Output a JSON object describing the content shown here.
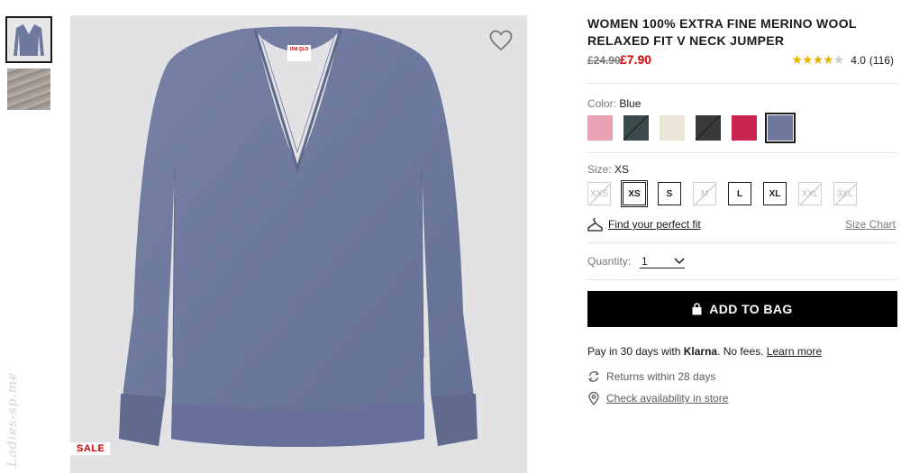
{
  "product": {
    "title": "WOMEN 100% EXTRA FINE MERINO WOOL RELAXED FIT V NECK JUMPER",
    "old_price": "£24.90",
    "new_price": "£7.90",
    "rating_value": "4.0",
    "review_count": "(116)",
    "rating_stars": 4,
    "sale_badge": "SALE",
    "brand_tag": "UNI QLO"
  },
  "watermark": "Ladies-sp.me",
  "color": {
    "label": "Color:",
    "selected": "Blue",
    "swatches": [
      {
        "name": "pink",
        "hex": "#e8a3b4",
        "available": true
      },
      {
        "name": "dark-green",
        "hex": "#3b4a4c",
        "available": false
      },
      {
        "name": "off-white",
        "hex": "#ece6d8",
        "available": true
      },
      {
        "name": "dark-grey",
        "hex": "#3a3939",
        "available": false
      },
      {
        "name": "magenta",
        "hex": "#c8254e",
        "available": true
      },
      {
        "name": "blue",
        "hex": "#6f799e",
        "available": true,
        "selected": true
      }
    ]
  },
  "size": {
    "label": "Size:",
    "selected": "XS",
    "options": [
      {
        "label": "XXS",
        "available": false
      },
      {
        "label": "XS",
        "available": true,
        "selected": true
      },
      {
        "label": "S",
        "available": true
      },
      {
        "label": "M",
        "available": false
      },
      {
        "label": "L",
        "available": true
      },
      {
        "label": "XL",
        "available": true
      },
      {
        "label": "XXL",
        "available": false
      },
      {
        "label": "3XL",
        "available": false
      }
    ]
  },
  "fit": {
    "find_link": "Find your perfect fit",
    "size_chart": "Size Chart"
  },
  "quantity": {
    "label": "Quantity:",
    "value": "1"
  },
  "cart": {
    "add_label": "ADD TO BAG"
  },
  "klarna": {
    "prefix": "Pay in 30 days with ",
    "brand": "Klarna",
    "suffix": ". No fees. ",
    "link": "Learn more"
  },
  "returns": "Returns within 28 days",
  "store": "Check availability in store",
  "colors": {
    "accent_red": "#dd0000",
    "sweater": "#6f799e",
    "background": "#e2e2e5"
  }
}
